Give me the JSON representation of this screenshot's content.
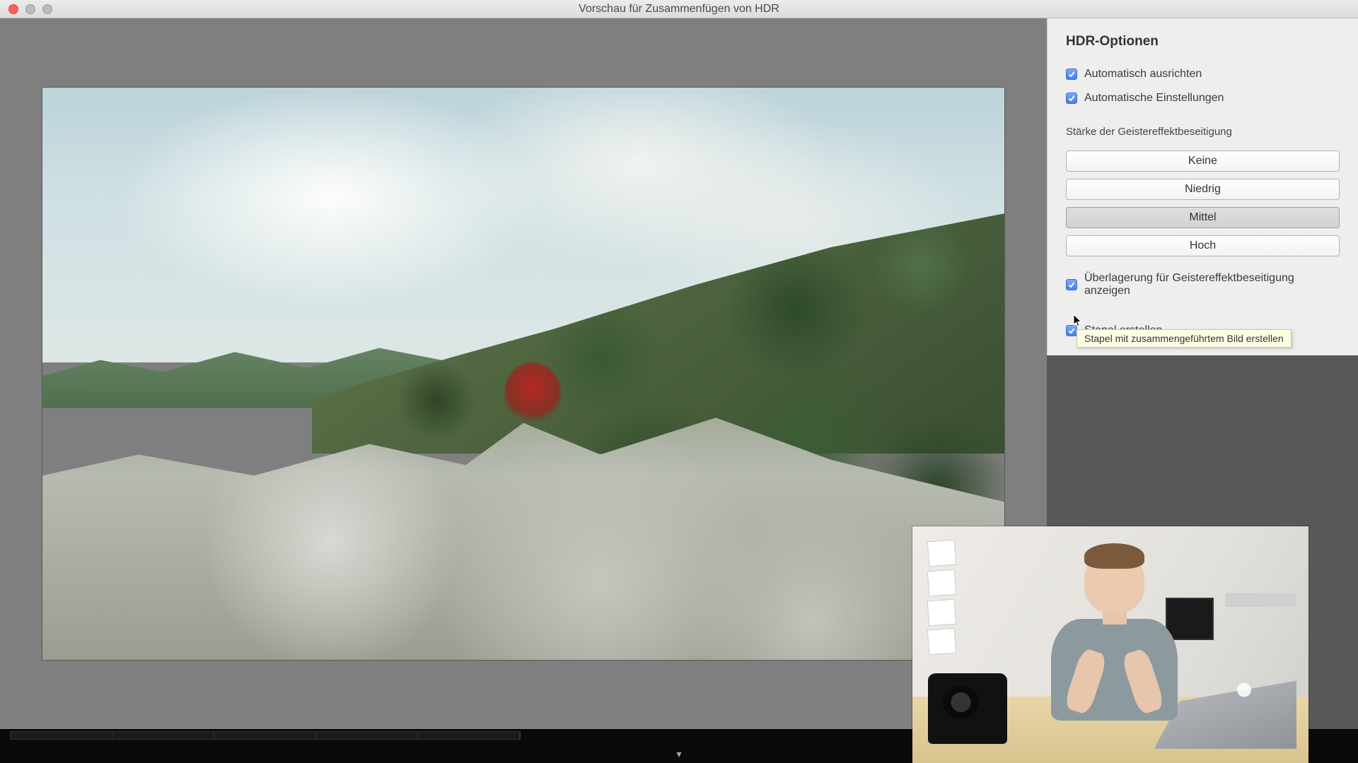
{
  "window": {
    "title": "Vorschau für Zusammenfügen von HDR"
  },
  "panel": {
    "heading": "HDR-Optionen",
    "auto_align": {
      "label": "Automatisch ausrichten",
      "checked": true
    },
    "auto_settings": {
      "label": "Automatische Einstellungen",
      "checked": true
    },
    "deghost_heading": "Stärke der Geistereffektbeseitigung",
    "deghost_options": {
      "none": "Keine",
      "low": "Niedrig",
      "medium": "Mittel",
      "high": "Hoch",
      "selected": "medium"
    },
    "show_overlay": {
      "label": "Überlagerung für Geistereffektbeseitigung anzeigen",
      "checked": true
    },
    "create_stack": {
      "label": "Stapel erstellen",
      "checked": true
    },
    "tooltip": "Stapel mit zusammengeführtem Bild erstellen"
  },
  "filmstrip": {
    "thumb_count": 5
  }
}
